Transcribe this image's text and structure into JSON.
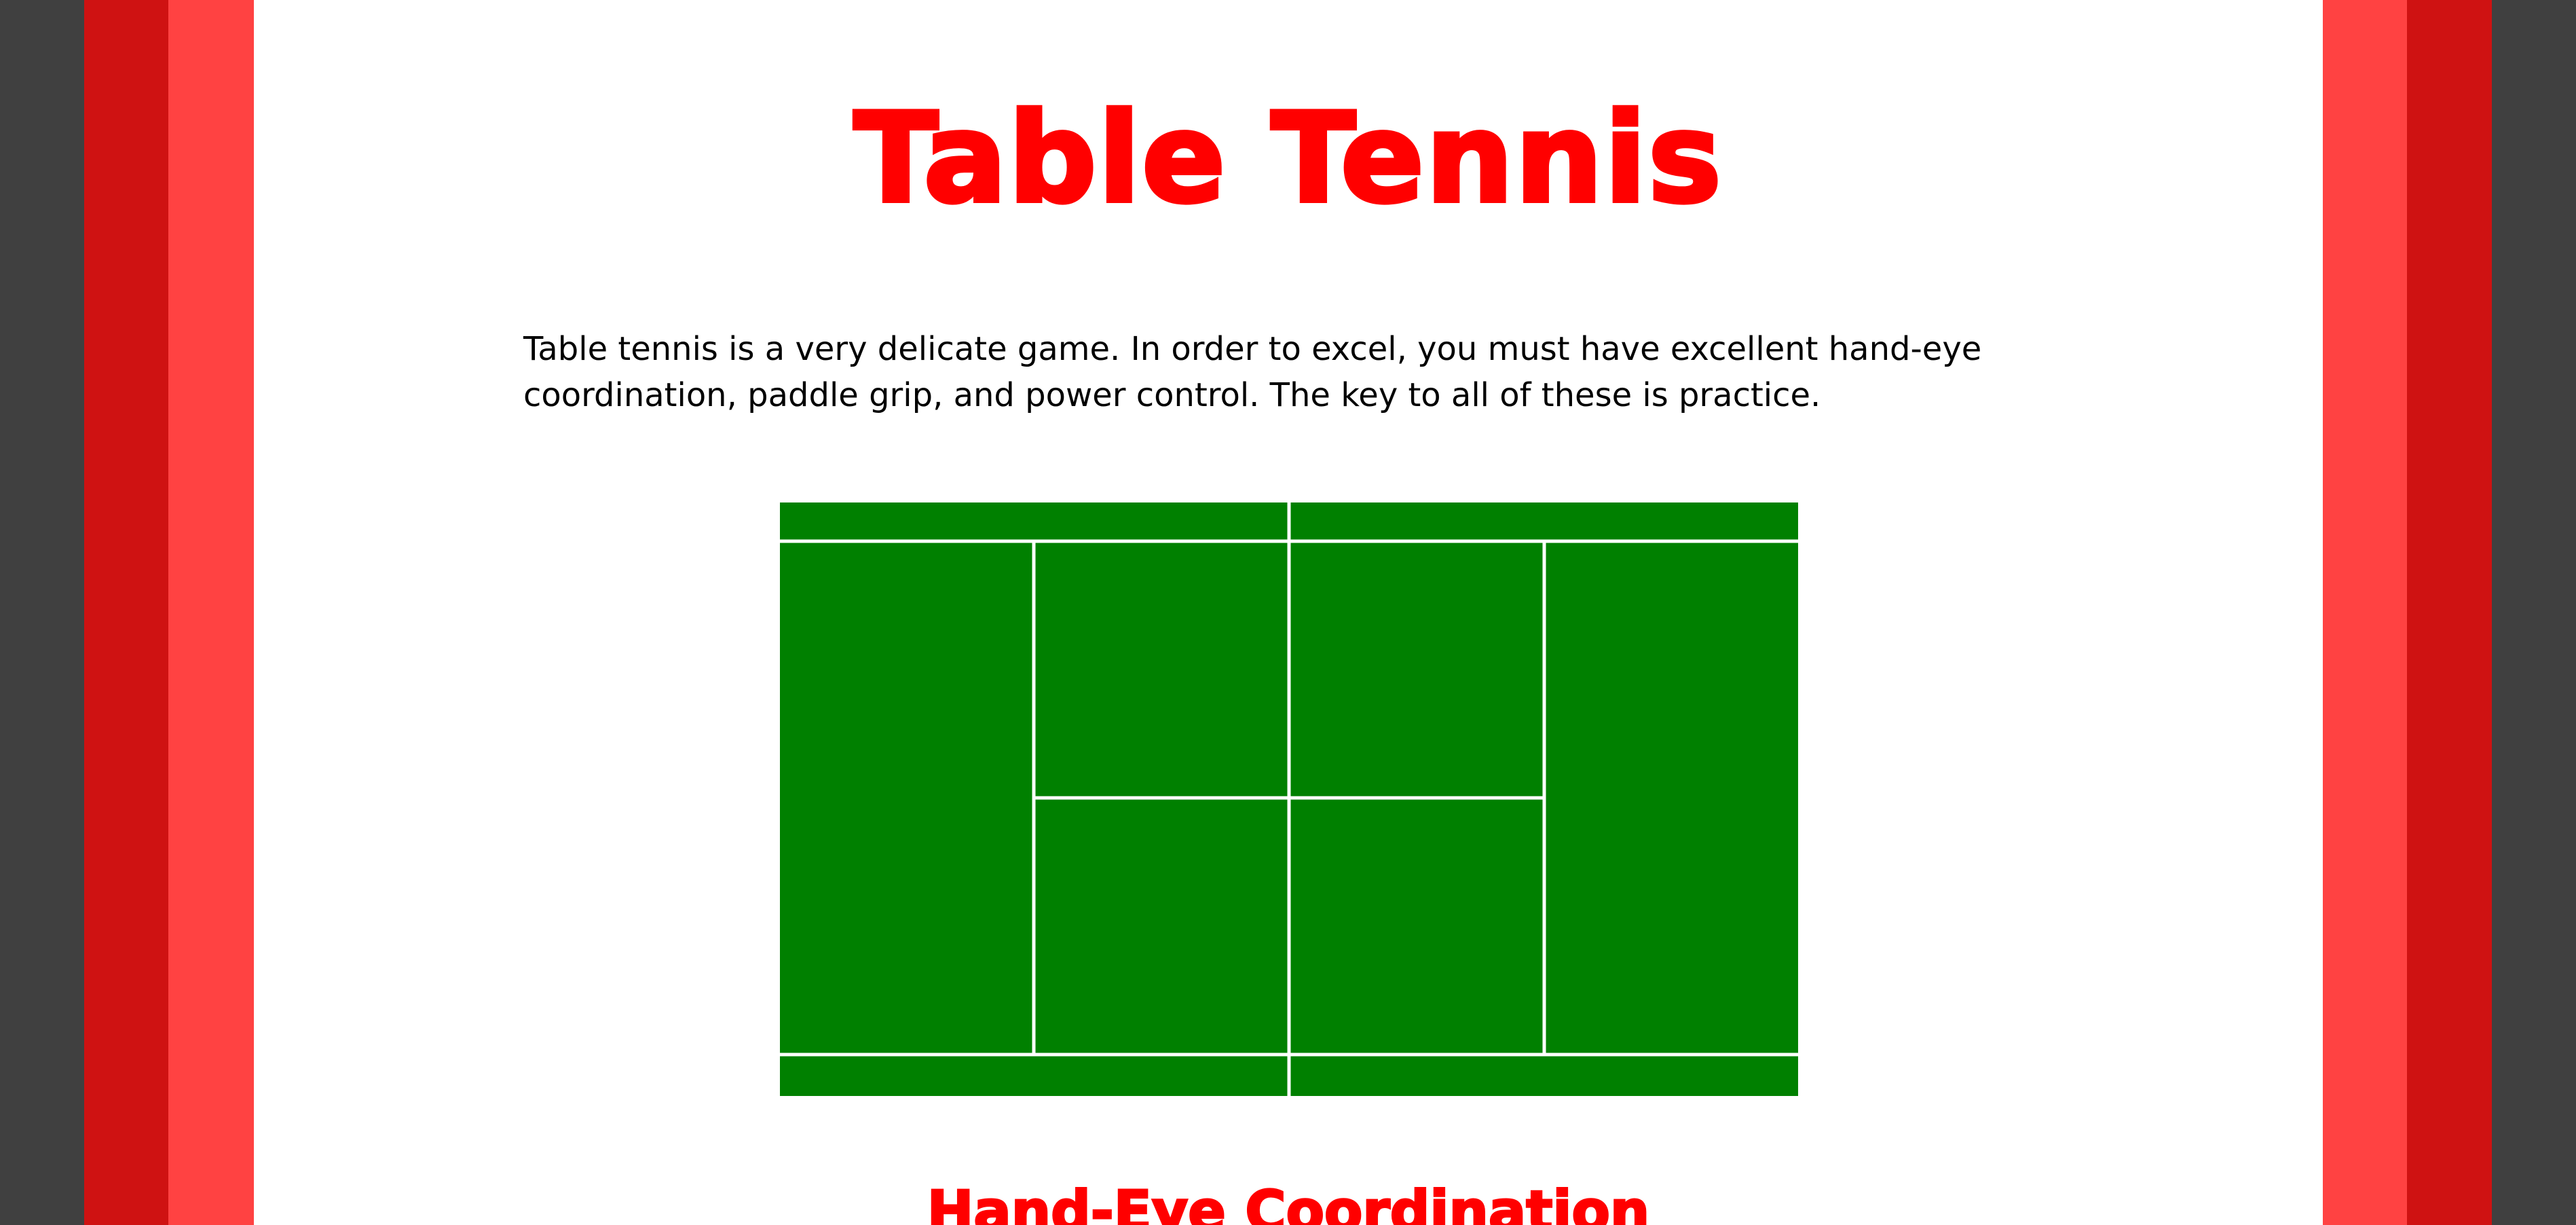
{
  "colors": {
    "frame_dark": "#404040",
    "frame_red": "#cf1212",
    "frame_pink": "#ff4242",
    "heading_red": "#ff0000",
    "court_green": "#008000",
    "court_lines": "#ffffff",
    "body_text": "#000000"
  },
  "page": {
    "title": "Table Tennis",
    "intro": "Table tennis is a very delicate game. In order to excel, you must have excellent hand-eye coordination, paddle grip, and power control. The key to all of these is practice.",
    "court_graphic": "table-tennis-court",
    "section_heading": "Hand-Eye Coordination"
  }
}
